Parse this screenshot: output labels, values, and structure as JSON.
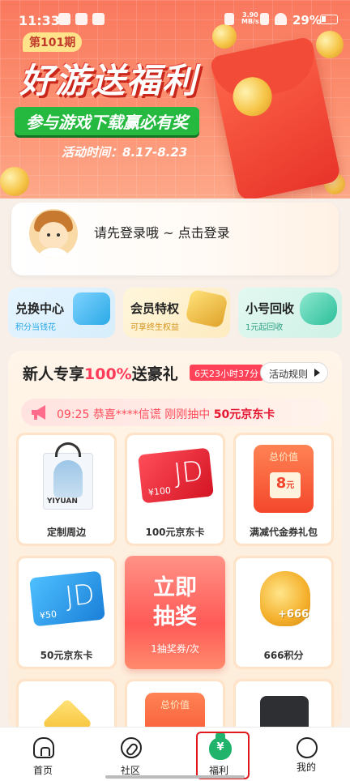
{
  "status_bar": {
    "time": "11:33",
    "speed_value": "3.90",
    "speed_unit": "MB/s",
    "battery": "29%"
  },
  "banner": {
    "issue": "第101期",
    "title": "好游送福利",
    "subtitle": "参与游戏下载赢必有奖",
    "date": "活动时间：8.17-8.23"
  },
  "login": {
    "prompt": "请先登录哦 ~ 点击登录"
  },
  "features": [
    {
      "title": "兑换中心",
      "subtitle": "积分当钱花",
      "accent": "#2aa9e6"
    },
    {
      "title": "会员特权",
      "subtitle": "可享终生权益",
      "accent": "#e0a32a"
    },
    {
      "title": "小号回收",
      "subtitle": "1元起回收",
      "accent": "#2bbf9a"
    }
  ],
  "newbie": {
    "title_prefix": "新人专享",
    "title_highlight": "100%",
    "title_suffix": "送豪礼",
    "timer": "6天23小时37分",
    "rules_button": "活动规则"
  },
  "notice": {
    "time": "09:25",
    "user": "恭喜****信谎",
    "action": "刚刚抽中",
    "prize": "50元京东卡"
  },
  "prizes": [
    {
      "label": "定制周边",
      "tote_text": "YIYUAN"
    },
    {
      "label": "100元京东卡",
      "card_brand": "JD",
      "card_value": "¥100"
    },
    {
      "label": "满减代金券礼包",
      "voucher_head": "总价值",
      "voucher_amount": "8",
      "voucher_unit": "元"
    },
    {
      "label": "50元京东卡",
      "card_brand": "JD",
      "card_value": "¥50"
    },
    {
      "label": "666积分",
      "points": "+666"
    },
    {
      "voucher_head": "总价值"
    }
  ],
  "draw": {
    "title_line1": "立即",
    "title_line2": "抽奖",
    "subtitle": "1抽奖券/次"
  },
  "nav": [
    {
      "label": "首页",
      "icon": "home-icon"
    },
    {
      "label": "社区",
      "icon": "compass-icon"
    },
    {
      "label": "福利",
      "icon": "money-bag-icon",
      "money_symbol": "¥"
    },
    {
      "label": "我的",
      "icon": "profile-face-icon"
    }
  ],
  "colors": {
    "accent_red": "#ff3b5a",
    "nav_active": "#1fb36b",
    "banner_green": "#25b940"
  }
}
